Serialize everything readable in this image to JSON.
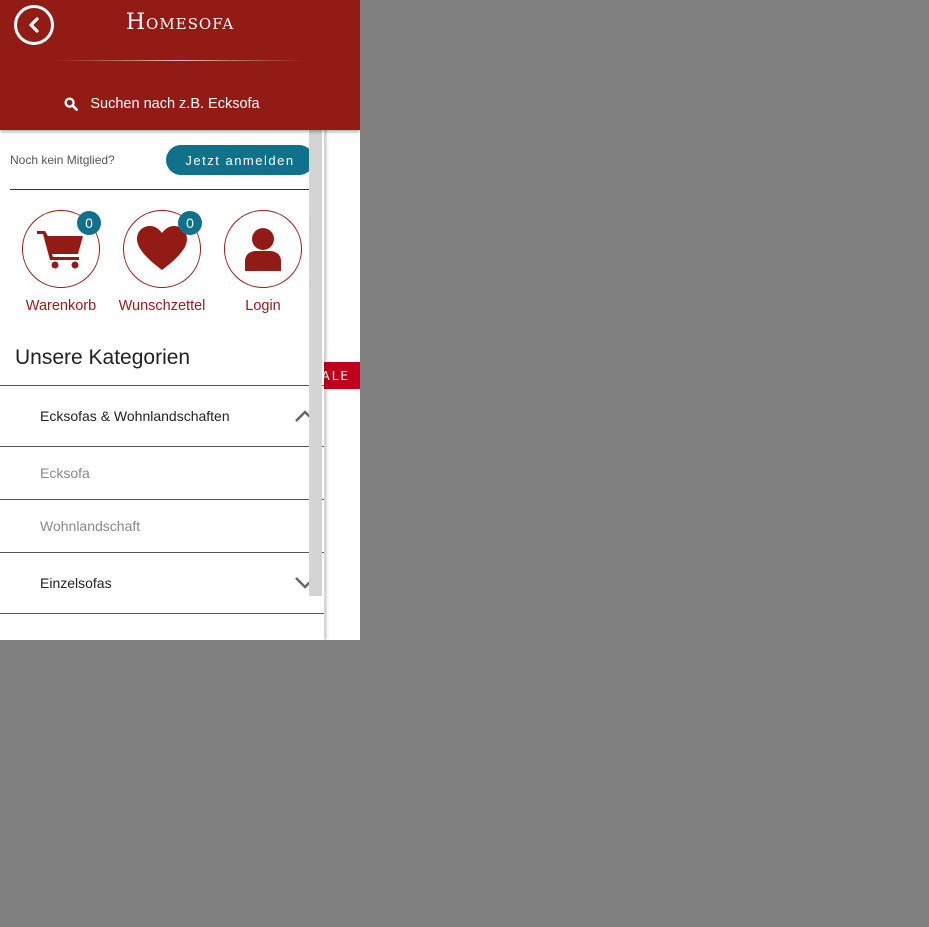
{
  "header": {
    "brand": "Homesofa",
    "search_label": "Suchen nach z.B. Ecksofa"
  },
  "member": {
    "text": "Noch kein Mitglied?",
    "signup_label": "Jetzt anmelden"
  },
  "icons": [
    {
      "name": "cart-icon",
      "label": "Warenkorb",
      "count": "0"
    },
    {
      "name": "heart-icon",
      "label": "Wunschzettel",
      "count": "0"
    },
    {
      "name": "user-icon",
      "label": "Login"
    }
  ],
  "categories": {
    "heading": "Unsere Kategorien",
    "items": [
      {
        "label": "Ecksofas & Wohnlandschaften",
        "type": "main",
        "state": "expanded"
      },
      {
        "label": "Ecksofa",
        "type": "sub"
      },
      {
        "label": "Wohnlandschaft",
        "type": "sub"
      },
      {
        "label": "Einzelsofas",
        "type": "main",
        "state": "collapsed"
      }
    ]
  },
  "background_page": {
    "sale_badge": "ALE"
  },
  "colors": {
    "brand_red": "#921b16",
    "accent_teal": "#11708a",
    "overlay_gray": "#808080"
  }
}
